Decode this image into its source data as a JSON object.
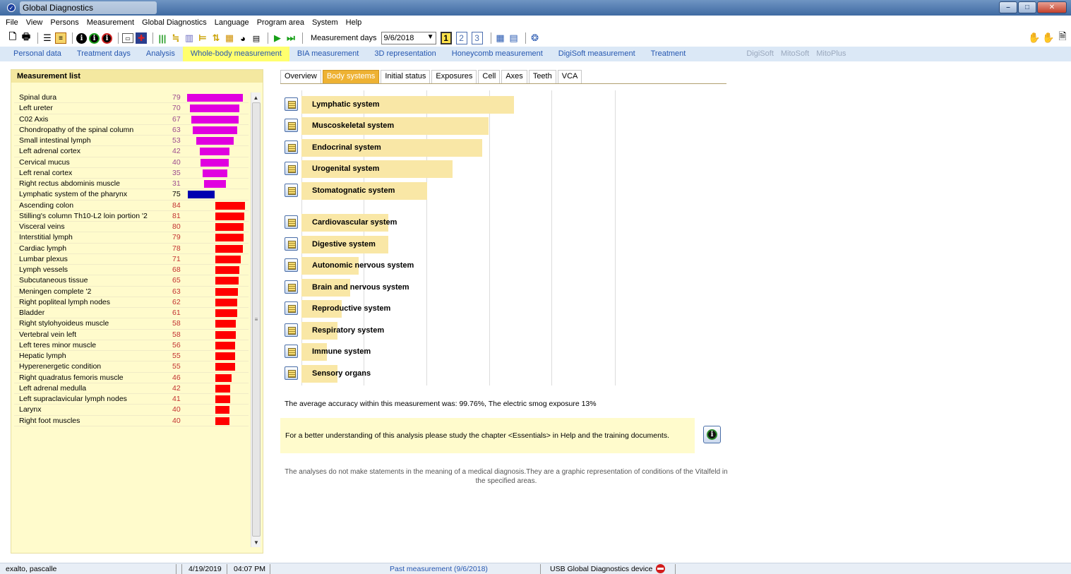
{
  "window": {
    "title": "Global Diagnostics"
  },
  "menu": [
    "File",
    "View",
    "Persons",
    "Measurement",
    "Global Diagnostics",
    "Language",
    "Program area",
    "System",
    "Help"
  ],
  "toolbar": {
    "measurement_days_label": "Measurement days",
    "measurement_date": "9/6/2018",
    "day_buttons": [
      "1",
      "2",
      "3"
    ],
    "active_day": "1"
  },
  "nav_tabs": {
    "items": [
      "Personal data",
      "Treatment days",
      "Analysis",
      "Whole-body measurement",
      "BIA measurement",
      "3D representation",
      "Honeycomb measurement",
      "DigiSoft measurement",
      "Treatment"
    ],
    "active": "Whole-body measurement",
    "extra": [
      "DigiSoft",
      "MitoSoft",
      "MitoPlus"
    ]
  },
  "measurement_list": {
    "title": "Measurement list",
    "items": [
      {
        "name": "Spinal dura",
        "value": 79,
        "category": "magenta"
      },
      {
        "name": "Left ureter",
        "value": 70,
        "category": "magenta"
      },
      {
        "name": "C02 Axis",
        "value": 67,
        "category": "magenta"
      },
      {
        "name": "Chondropathy of the spinal column",
        "value": 63,
        "category": "magenta"
      },
      {
        "name": "Small intestinal lymph",
        "value": 53,
        "category": "magenta"
      },
      {
        "name": "Left adrenal cortex",
        "value": 42,
        "category": "magenta"
      },
      {
        "name": "Cervical mucus",
        "value": 40,
        "category": "magenta"
      },
      {
        "name": "Left renal cortex",
        "value": 35,
        "category": "magenta"
      },
      {
        "name": "Right rectus abdominis muscle",
        "value": 31,
        "category": "magenta"
      },
      {
        "name": "Lymphatic system of the pharynx",
        "value": 75,
        "category": "blue"
      },
      {
        "name": "Ascending colon",
        "value": 84,
        "category": "red"
      },
      {
        "name": "Stilling's column Th10-L2 loin portion '2",
        "value": 81,
        "category": "red"
      },
      {
        "name": "Visceral veins",
        "value": 80,
        "category": "red"
      },
      {
        "name": "Interstitial lymph",
        "value": 79,
        "category": "red"
      },
      {
        "name": "Cardiac lymph",
        "value": 78,
        "category": "red"
      },
      {
        "name": "Lumbar plexus",
        "value": 71,
        "category": "red"
      },
      {
        "name": "Lymph vessels",
        "value": 68,
        "category": "red"
      },
      {
        "name": "Subcutaneous tissue",
        "value": 65,
        "category": "red"
      },
      {
        "name": "Meningen complete '2",
        "value": 63,
        "category": "red"
      },
      {
        "name": "Right popliteal lymph nodes",
        "value": 62,
        "category": "red"
      },
      {
        "name": "Bladder",
        "value": 61,
        "category": "red"
      },
      {
        "name": "Right stylohyoideus muscle",
        "value": 58,
        "category": "red"
      },
      {
        "name": "Vertebral vein left",
        "value": 58,
        "category": "red"
      },
      {
        "name": "Left teres minor muscle",
        "value": 56,
        "category": "red"
      },
      {
        "name": "Hepatic lymph",
        "value": 55,
        "category": "red"
      },
      {
        "name": "Hyperenergetic condition",
        "value": 55,
        "category": "red"
      },
      {
        "name": "Right quadratus femoris muscle",
        "value": 46,
        "category": "red"
      },
      {
        "name": "Left adrenal medulla",
        "value": 42,
        "category": "red"
      },
      {
        "name": "Left supraclavicular lymph nodes",
        "value": 41,
        "category": "red"
      },
      {
        "name": "Larynx",
        "value": 40,
        "category": "red"
      },
      {
        "name": "Right foot muscles",
        "value": 40,
        "category": "red"
      }
    ]
  },
  "colors": {
    "magenta": "#e000e0",
    "red": "#ff0000",
    "blue": "#0000b0"
  },
  "sub_tabs": {
    "items": [
      "Overview",
      "Body systems",
      "Initial status",
      "Exposures",
      "Cell",
      "Axes",
      "Teeth",
      "VCA"
    ],
    "active": "Body systems"
  },
  "body_systems": [
    {
      "label": "Lymphatic system",
      "level": 1.0
    },
    {
      "label": "Muscoskeletal system",
      "level": 0.88
    },
    {
      "label": "Endocrinal system",
      "level": 0.85
    },
    {
      "label": "Urogenital system",
      "level": 0.71
    },
    {
      "label": "Stomatognatic system",
      "level": 0.59
    },
    {
      "label": "Cardiovascular system",
      "level": 0.41
    },
    {
      "label": "Digestive system",
      "level": 0.41
    },
    {
      "label": "Autonomic nervous system",
      "level": 0.27
    },
    {
      "label": "Brain and nervous system",
      "level": 0.23
    },
    {
      "label": "Reproductive system",
      "level": 0.19
    },
    {
      "label": "Respiratory system",
      "level": 0.17
    },
    {
      "label": "Immune system",
      "level": 0.12
    },
    {
      "label": "Sensory organs",
      "level": 0.17
    }
  ],
  "accuracy_text": "The average accuracy within this measurement was: 99.76%, The electric smog exposure 13%",
  "info_text": "For a better understanding of this analysis please study the chapter <Essentials> in Help and the training documents.",
  "disclaimer": "The analyses do not make statements in the meaning of a medical diagnosis.They are a graphic representation of conditions of the Vitalfeld in the specified areas.",
  "status": {
    "user": "exalto, pascalle",
    "date": "4/19/2019",
    "time": "04:07 PM",
    "measurement": "Past measurement (9/6/2018)",
    "device": "USB Global Diagnostics device"
  }
}
